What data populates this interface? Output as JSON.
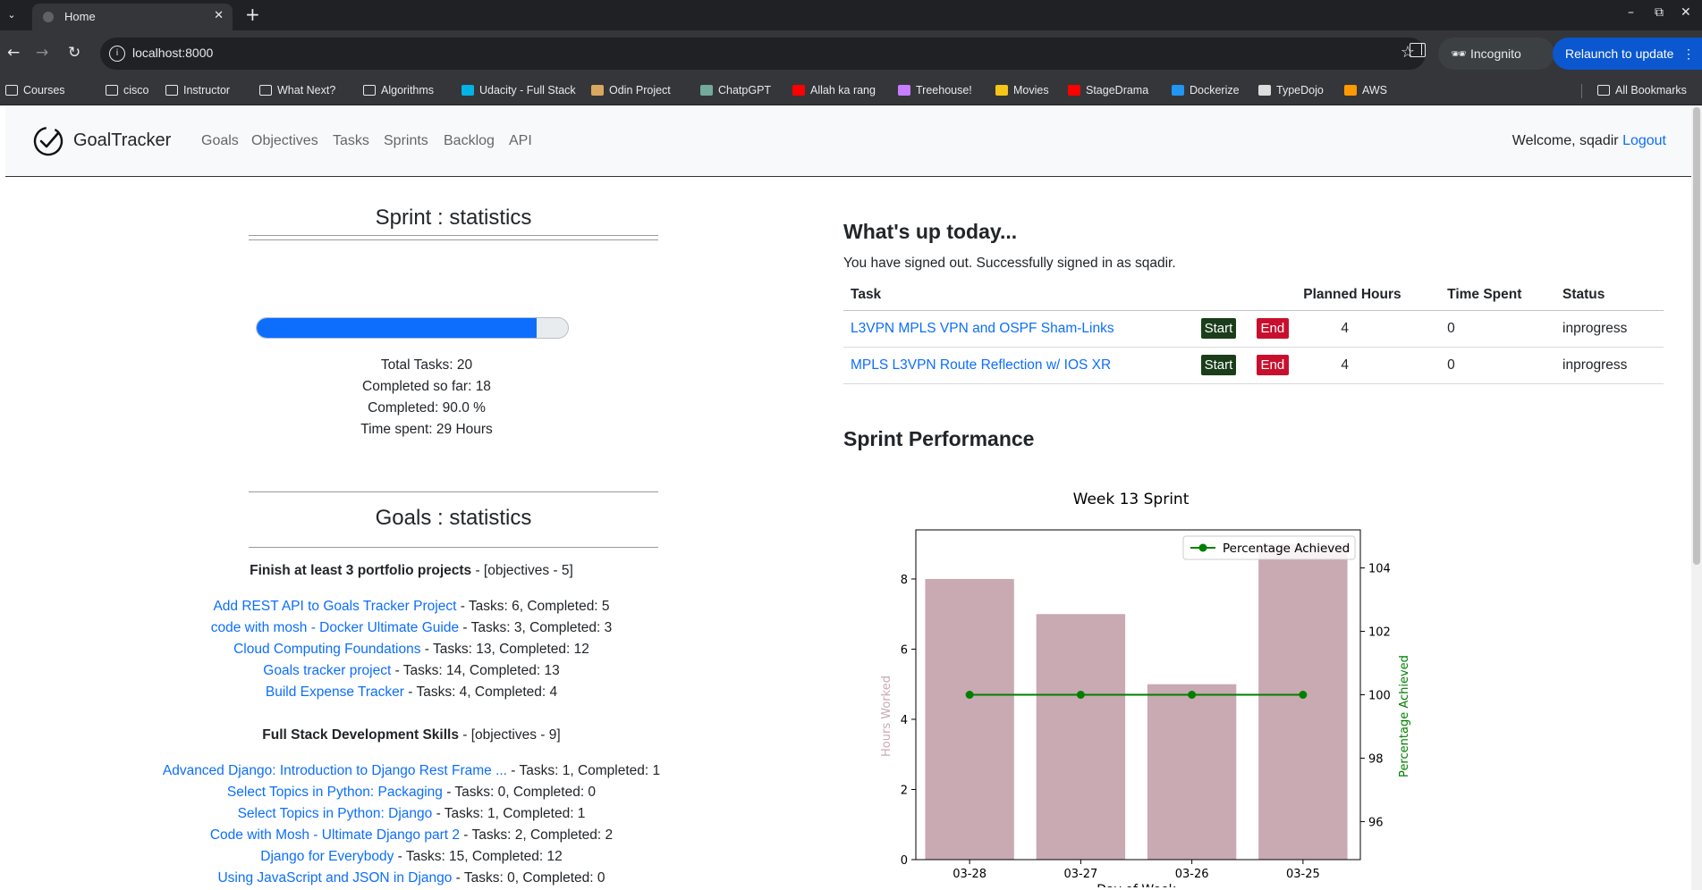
{
  "browser": {
    "tab_title": "Home",
    "url": "localhost:8000",
    "incognito_label": "Incognito",
    "relaunch_label": "Relaunch to update",
    "bookmarks": [
      {
        "label": "Courses",
        "icon": "folder-icon"
      },
      {
        "label": "cisco",
        "icon": "folder-icon"
      },
      {
        "label": "Instructor",
        "icon": "folder-icon"
      },
      {
        "label": "What Next?",
        "icon": "folder-icon"
      },
      {
        "label": "Algorithms",
        "icon": "folder-icon"
      },
      {
        "label": "Udacity - Full Stack",
        "icon": "udacity-icon"
      },
      {
        "label": "Odin Project",
        "icon": "odin-icon"
      },
      {
        "label": "ChatpGPT",
        "icon": "chatgpt-icon"
      },
      {
        "label": "Allah ka rang",
        "icon": "youtube-icon"
      },
      {
        "label": "Treehouse!",
        "icon": "treehouse-icon"
      },
      {
        "label": "Movies",
        "icon": "movies-icon"
      },
      {
        "label": "StageDrama",
        "icon": "youtube-icon"
      },
      {
        "label": "Dockerize",
        "icon": "play-icon"
      },
      {
        "label": "TypeDojo",
        "icon": "typedojo-icon"
      },
      {
        "label": "AWS",
        "icon": "aws-icon"
      }
    ],
    "all_bookmarks_label": "All Bookmarks"
  },
  "app": {
    "brand": "GoalTracker",
    "nav": [
      "Goals",
      "Objectives",
      "Tasks",
      "Sprints",
      "Backlog",
      "API"
    ],
    "welcome": "Welcome, sqadir",
    "logout": "Logout"
  },
  "sprint_stats": {
    "title": "Sprint : statistics",
    "progress": 0.9,
    "lines": [
      "Total Tasks: 20",
      "Completed so far: 18",
      "Completed: 90.0 %",
      "Time spent: 29 Hours"
    ]
  },
  "goal_stats": {
    "title": "Goals : statistics",
    "goals": [
      {
        "name": "Finish at least 3 portfolio projects",
        "suffix": " - [objectives - 5]",
        "objectives": [
          {
            "name": "Add REST API to Goals Tracker Project",
            "info": " - Tasks: 6, Completed: 5"
          },
          {
            "name": "code with mosh - Docker Ultimate Guide",
            "info": " - Tasks: 3, Completed: 3"
          },
          {
            "name": "Cloud Computing Foundations",
            "info": " - Tasks: 13, Completed: 12"
          },
          {
            "name": "Goals tracker project",
            "info": " - Tasks: 14, Completed: 13"
          },
          {
            "name": "Build Expense Tracker",
            "info": " - Tasks: 4, Completed: 4"
          }
        ]
      },
      {
        "name": "Full Stack Development Skills",
        "suffix": " - [objectives - 9]",
        "objectives": [
          {
            "name": "Advanced Django: Introduction to Django Rest Frame ...",
            "info": " - Tasks: 1, Completed: 1"
          },
          {
            "name": "Select Topics in Python: Packaging",
            "info": " - Tasks: 0, Completed: 0"
          },
          {
            "name": "Select Topics in Python: Django",
            "info": " - Tasks: 1, Completed: 1"
          },
          {
            "name": "Code with Mosh - Ultimate Django part 2",
            "info": " - Tasks: 2, Completed: 2"
          },
          {
            "name": "Django for Everybody",
            "info": " - Tasks: 15, Completed: 12"
          },
          {
            "name": "Using JavaScript and JSON in Django",
            "info": " - Tasks: 0, Completed: 0"
          }
        ]
      }
    ]
  },
  "today": {
    "title": "What's up today...",
    "message": "You have signed out. Successfully signed in as sqadir.",
    "headers": [
      "Task",
      "",
      "",
      "Planned Hours",
      "Time Spent",
      "Status"
    ],
    "start_label": "Start",
    "end_label": "End",
    "rows": [
      {
        "task": "L3VPN MPLS VPN and OSPF Sham-Links",
        "planned": "4",
        "spent": "0",
        "status": "inprogress"
      },
      {
        "task": "MPLS L3VPN Route Reflection w/ IOS XR",
        "planned": "4",
        "spent": "0",
        "status": "inprogress"
      }
    ]
  },
  "performance": {
    "title": "Sprint Performance"
  },
  "chart_data": {
    "type": "bar",
    "title": "Week 13 Sprint",
    "xlabel": "Day of Week",
    "ylabel": "Hours Worked",
    "ylabel_right": "Percentage Achieved",
    "categories": [
      "03-28",
      "03-27",
      "03-26",
      "03-25"
    ],
    "series": [
      {
        "name": "Hours Worked",
        "type": "bar",
        "axis": "left",
        "values": [
          8,
          7,
          5,
          9
        ],
        "color": "#c9a9b2"
      },
      {
        "name": "Percentage Achieved",
        "type": "line",
        "axis": "right",
        "values": [
          100,
          100,
          100,
          100
        ],
        "color": "#008000"
      }
    ],
    "ylim": [
      0,
      9.4
    ],
    "ylim_right": [
      94.8,
      105.2
    ],
    "yticks": [
      0,
      2,
      4,
      6,
      8
    ],
    "yticks_right": [
      96,
      98,
      100,
      102,
      104
    ],
    "legend_position": "top-right",
    "ylabel_color": "#c9a9b2",
    "ylabel_right_color": "#008000"
  }
}
